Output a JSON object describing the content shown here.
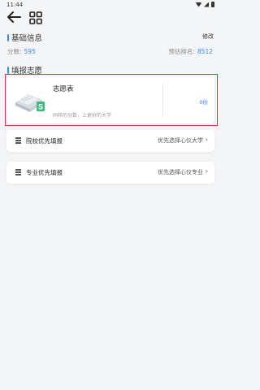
{
  "status_bar": {
    "time": "11:44"
  },
  "basic_info": {
    "title": "基础信息",
    "edit_label": "修改",
    "score_label": "分数:",
    "score_value": "595",
    "rank_label": "预估排名:",
    "rank_value": "8512"
  },
  "fill_section": {
    "title": "填报志愿"
  },
  "wish_card": {
    "title": "志愿表",
    "subtitle": "同样的分数，上更好的大学",
    "count": "0份"
  },
  "options": [
    {
      "label": "院校优先填报",
      "hint": "优先选择心仪大学"
    },
    {
      "label": "专业优先填报",
      "hint": "优先选择心仪专业"
    }
  ],
  "colors": {
    "accent": "#3a86ff",
    "highlight": "#e0353e",
    "icon_green": "#3dbb7a"
  }
}
